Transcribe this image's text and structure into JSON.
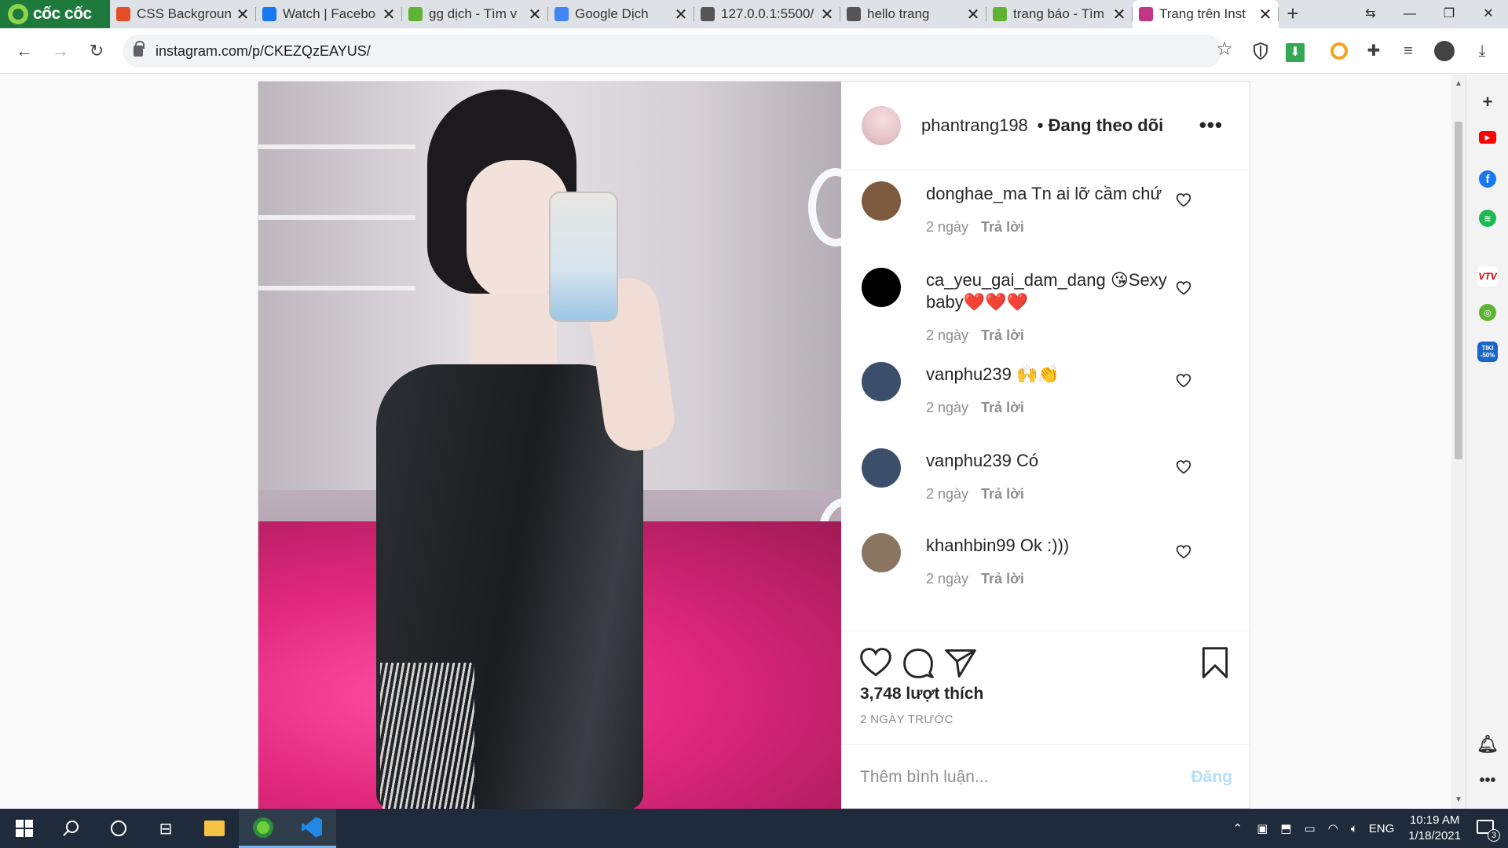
{
  "browser": {
    "brand": "cốc cốc",
    "tabs": [
      {
        "title": "CSS Backgroun",
        "fav_color": "#e44d26"
      },
      {
        "title": "Watch | Facebo",
        "fav_color": "#1877f2"
      },
      {
        "title": "gg dịch - Tìm v",
        "fav_color": "#5fb233"
      },
      {
        "title": "Google Dịch",
        "fav_color": "#4285f4"
      },
      {
        "title": "127.0.0.1:5500/",
        "fav_color": "#555555"
      },
      {
        "title": "hello trang",
        "fav_color": "#555555"
      },
      {
        "title": "trang báo - Tìm",
        "fav_color": "#5fb233"
      },
      {
        "title": "Trang trên Inst",
        "fav_color": "#c13584"
      }
    ],
    "url": "instagram.com/p/CKEZQzEAYUS/"
  },
  "post": {
    "owner": "phantrang198",
    "follow_status": "• Đang theo dõi",
    "comments": [
      {
        "user": "donghae_ma",
        "text": "Tn ai lỡ cầm chứ",
        "time": "2 ngày",
        "reply": "Trả lời",
        "avatar_color": "#7d5b3e"
      },
      {
        "user": "ca_yeu_gai_dam_dang",
        "text": "😘Sexy baby❤️❤️❤️",
        "time": "2 ngày",
        "reply": "Trả lời",
        "avatar_color": "#000000"
      },
      {
        "user": "vanphu239",
        "text": "🙌👏",
        "time": "2 ngày",
        "reply": "Trả lời",
        "avatar_color": "#3b4f6a"
      },
      {
        "user": "vanphu239",
        "text": "Có",
        "time": "2 ngày",
        "reply": "Trả lời",
        "avatar_color": "#3b4f6a"
      },
      {
        "user": "khanhbin99",
        "text": "Ok :)))",
        "time": "2 ngày",
        "reply": "Trả lời",
        "avatar_color": "#8a7560"
      }
    ],
    "likes": "3,748 lượt thích",
    "posted": "2 NGÀY TRƯỚC",
    "comment_placeholder": "Thêm bình luận...",
    "post_button": "Đăng"
  },
  "taskbar": {
    "language": "ENG",
    "time": "10:19 AM",
    "date": "1/18/2021",
    "notifications": "3"
  }
}
